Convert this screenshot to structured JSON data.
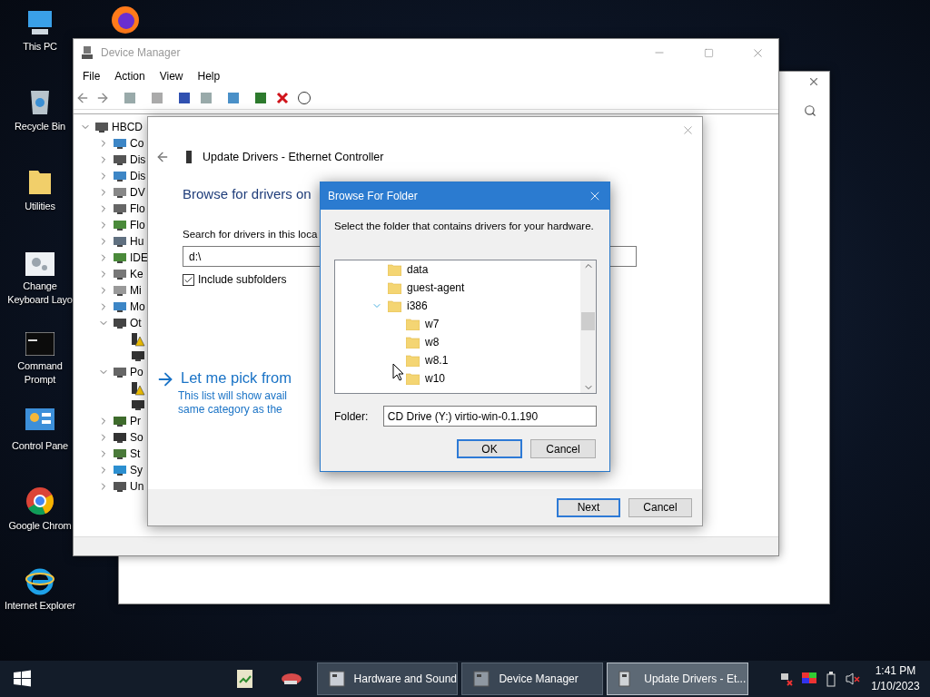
{
  "desktop": {
    "icons": [
      {
        "label": "This PC"
      },
      {
        "label": "Recycle Bin"
      },
      {
        "label": "Utilities"
      },
      {
        "label": "Change Keyboard Layo"
      },
      {
        "label": "Command Prompt"
      },
      {
        "label": "Control Pane"
      },
      {
        "label": "Google Chrom"
      },
      {
        "label": "Internet Explorer"
      }
    ]
  },
  "device_manager": {
    "title": "Device Manager",
    "menu": [
      "File",
      "Action",
      "View",
      "Help"
    ],
    "tree": {
      "label": "HBCD",
      "expanded": true,
      "children": [
        {
          "label": "Co",
          "expanded": false
        },
        {
          "label": "Dis",
          "expanded": false
        },
        {
          "label": "Dis",
          "expanded": false
        },
        {
          "label": "DV",
          "expanded": false
        },
        {
          "label": "Flo",
          "expanded": false
        },
        {
          "label": "Flo",
          "expanded": false
        },
        {
          "label": "Hu",
          "expanded": false
        },
        {
          "label": "IDE",
          "expanded": false
        },
        {
          "label": "Ke",
          "expanded": false
        },
        {
          "label": "Mi",
          "expanded": false
        },
        {
          "label": "Mo",
          "expanded": false
        },
        {
          "label": "Ot",
          "expanded": true,
          "children": [
            {
              "warning": true
            },
            {
              "warning": false
            }
          ]
        },
        {
          "label": "Po",
          "expanded": true,
          "children": [
            {
              "warning": true
            },
            {
              "warning": false
            }
          ]
        },
        {
          "label": "Pr",
          "expanded": false
        },
        {
          "label": "So",
          "expanded": false
        },
        {
          "label": "St",
          "expanded": false
        },
        {
          "label": "Sy",
          "expanded": false
        },
        {
          "label": "Un",
          "expanded": false
        }
      ]
    }
  },
  "update_drivers": {
    "title": "Update Drivers - Ethernet Controller",
    "heading": "Browse for drivers on",
    "search_label": "Search for drivers in this loca",
    "path": "d:\\",
    "include_subfolders": {
      "label": "Include subfolders",
      "checked": true
    },
    "pick_link": "Let me pick from",
    "pick_description": "This list will show avail\nsame category as the",
    "buttons": [
      {
        "label": "Next",
        "default": true
      },
      {
        "label": "Cancel",
        "default": false
      }
    ]
  },
  "browse_for_folder": {
    "title": "Browse For Folder",
    "prompt": "Select the folder that contains drivers for your hardware.",
    "tree": [
      {
        "label": "data",
        "expanded": false
      },
      {
        "label": "guest-agent",
        "expanded": false
      },
      {
        "label": "i386",
        "expanded": true,
        "children": [
          {
            "label": "w7",
            "expanded": false
          },
          {
            "label": "w8",
            "expanded": false
          },
          {
            "label": "w8.1",
            "expanded": false
          },
          {
            "label": "w10",
            "expanded": false
          }
        ]
      }
    ],
    "folder_label": "Folder:",
    "folder_value": "CD Drive (Y:) virtio-win-0.1.190",
    "buttons": [
      {
        "label": "OK",
        "default": true
      },
      {
        "label": "Cancel",
        "default": false
      }
    ]
  },
  "taskbar": {
    "tasks": [
      {
        "label": "Hardware and Sound",
        "selected": false
      },
      {
        "label": "Device Manager",
        "selected": false
      },
      {
        "label": "Update Drivers - Et...",
        "selected": true
      }
    ],
    "time": "1:41 PM",
    "date": "1/10/2023"
  }
}
